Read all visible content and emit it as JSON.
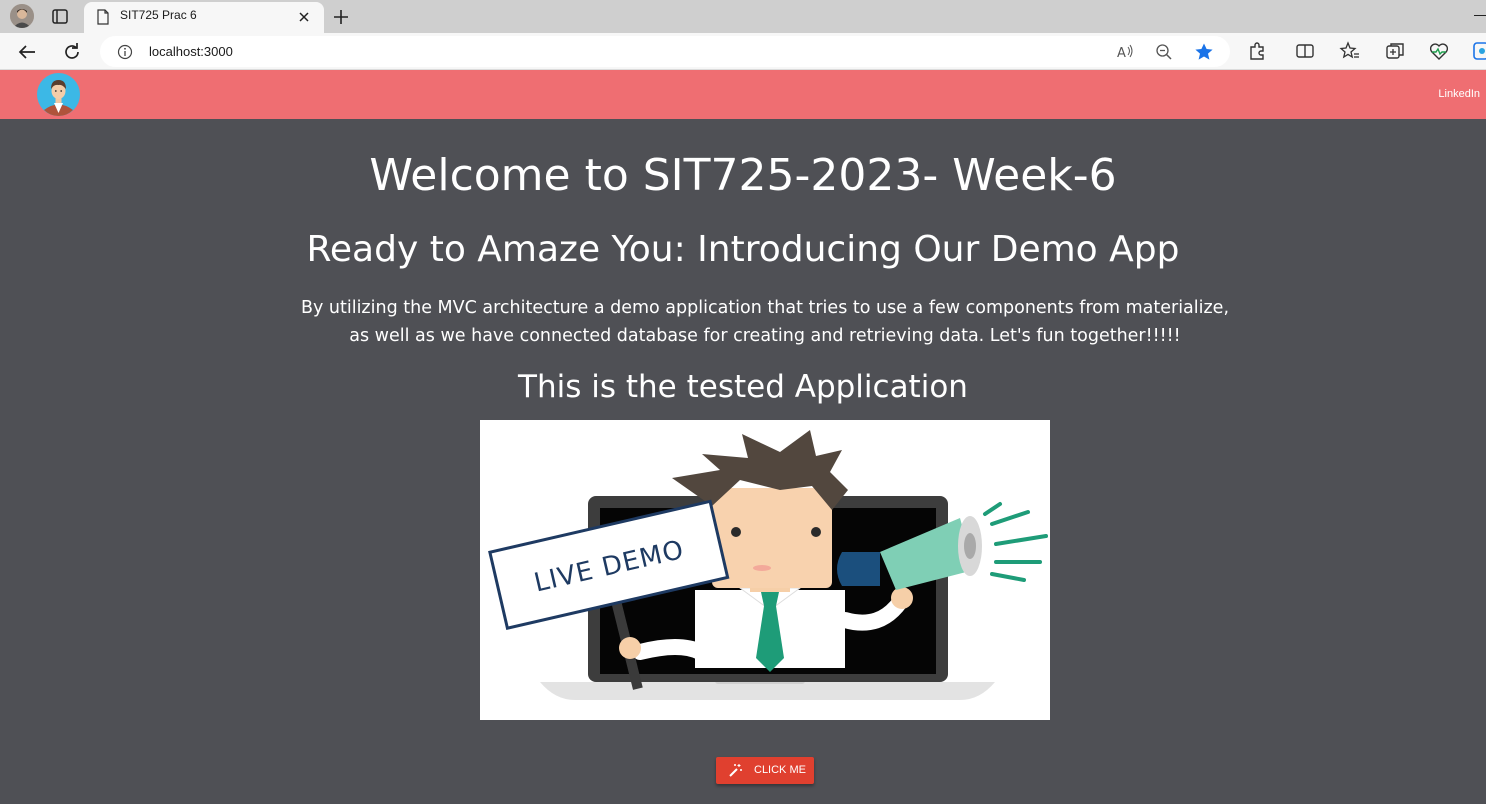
{
  "browser": {
    "tab_title": "SIT725 Prac 6",
    "url": "localhost:3000",
    "icons": {
      "profile": "profile-avatar",
      "tab_actions": "tab-actions-icon",
      "favicon": "page-icon",
      "close": "close-icon",
      "new_tab": "plus-icon",
      "back": "back-arrow-icon",
      "refresh": "refresh-icon",
      "info": "info-icon",
      "read_aloud": "read-aloud-icon",
      "zoom": "zoom-out-icon",
      "favorite": "star-icon",
      "extensions": "puzzle-icon",
      "split": "split-screen-icon",
      "favorites": "favorites-icon",
      "collections": "collections-icon",
      "performance": "heart-pulse-icon",
      "edge": "edge-icon"
    },
    "accent": "#1a73e8"
  },
  "navbar": {
    "link": "LinkedIn",
    "color": "#ef6e72"
  },
  "main": {
    "title": "Welcome to SIT725-2023- Week-6",
    "subtitle": "Ready to Amaze You: Introducing Our Demo App",
    "description": "By utilizing the MVC architecture a demo application that tries to use a few components from materialize, as well as we have connected database for creating and retrieving data. Let's fun together!!!!!",
    "section_title": "This is the tested Application",
    "image_sign_text": "LIVE DEMO",
    "button_label": "CLICK ME",
    "button_color": "#e0402f",
    "background": "#4f5055"
  }
}
